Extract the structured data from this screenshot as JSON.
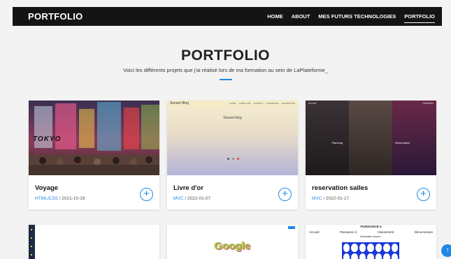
{
  "navbar": {
    "brand": "PORTFOLIO",
    "links": [
      "HOME",
      "ABOUT",
      "MES FUTURS TECHNOLOGIES",
      "PORTFOLIO"
    ],
    "active": "PORTFOLIO"
  },
  "hero": {
    "title": "PORTFOLIO",
    "subtitle": "Voici les différents projets que j'ai réalisé lors de ma formation au sein de LaPlateforme_"
  },
  "cards": [
    {
      "title": "Voyage",
      "tech": "HTML/CSS",
      "date": " / 2021-10-19",
      "thumb_text": "TOKYO"
    },
    {
      "title": "Livre d'or",
      "tech": "MVC",
      "date": " / 2022-01-07",
      "thumb_brand": "Sunset Blog",
      "thumb_text": "Sunset blog",
      "thumb_links": [
        "HOME",
        "LIVRE D'OR",
        "CONTACT",
        "CONNEXION",
        "INSCRIPTION"
      ]
    },
    {
      "title": "reservation salles",
      "tech": "MVC",
      "date": " / 2022-01-17",
      "thumb_labels": [
        "Accueil",
        "Calendrier",
        "Planning",
        "Réservation"
      ]
    }
  ],
  "row2": {
    "google_text": "Google",
    "card3_title": "PUISSANCE 4",
    "card3_menu": [
      "Accueil",
      "Puissance 4",
      "Classement",
      "Déconnexion"
    ],
    "card3_sub": "Information Joueur :"
  },
  "icons": {
    "plus": "plus-circle-icon",
    "scroll": "arrow-up-icon"
  },
  "colors": {
    "accent": "#1e88e5",
    "navbar": "#141414",
    "background": "#f3f3f3"
  }
}
